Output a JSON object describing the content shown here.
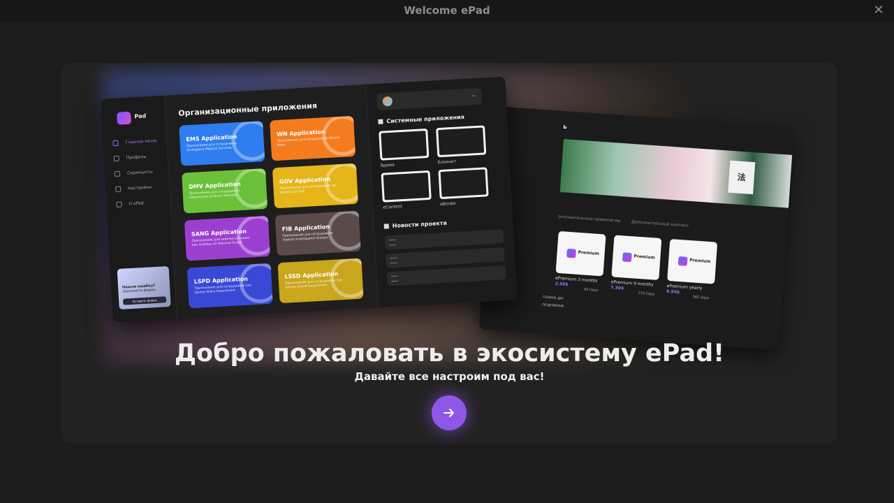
{
  "window": {
    "title": "Welcome ePad",
    "close_icon": "close-icon"
  },
  "preview": {
    "front": {
      "logo": "Pad",
      "nav": [
        "Главное меню",
        "Профиль",
        "Скриншоты",
        "Настройки",
        "O ePad"
      ],
      "promo": {
        "title": "Нашли ошибку?",
        "sub": "Заполните форму",
        "button": "Оставить форму"
      },
      "section_title": "Организационные приложения",
      "apps": [
        {
          "name": "EMS Application",
          "desc": "Приложение для сотрудников Emergency Medical Services",
          "color": "#2f7df0"
        },
        {
          "name": "WN Application",
          "desc": "Приложение для сотрудников Weazel News",
          "color": "#f47c1e"
        },
        {
          "name": "DMV Application",
          "desc": "Приложение для сотрудников Department of Motor Vehicles",
          "color": "#6cc13a"
        },
        {
          "name": "GOV Application",
          "desc": "Приложение для сотрудников Los Santos City Hall",
          "color": "#e5b51a"
        },
        {
          "name": "SANG Application",
          "desc": "Приложение для военнослужащих San Andreas Air National Guard",
          "color": "#9b3fd0"
        },
        {
          "name": "FIB Application",
          "desc": "Приложение для сотрудников Federal Investigation Bureau",
          "color": "#5a4a4a"
        },
        {
          "name": "LSPD Application",
          "desc": "Приложение для сотрудников Los-Santos Police Department",
          "color": "#3a48d6"
        },
        {
          "name": "LSSD Application",
          "desc": "Приложение для сотрудников Los-Santos Sheriff Department",
          "color": "#c9a61c"
        }
      ],
      "system_title": "Системные приложения",
      "system_apps": [
        "Время",
        "Блокнот",
        "eContent",
        "eBinder"
      ],
      "news_title": "Новости проекта"
    },
    "back": {
      "header": "ь",
      "tabs": [
        "ополнительные привилегии",
        "Дополнительный контент"
      ],
      "premium_label": "Premium",
      "plans": [
        {
          "name": "ePremium 3 months",
          "price": "2.50$",
          "days": "90 Days"
        },
        {
          "name": "ePremium 9 months",
          "price": "7.30$",
          "days": "270 Days"
        },
        {
          "name": "ePremium yearly",
          "price": "9.50$",
          "days": "365 Days"
        }
      ],
      "footer": [
        "плана до:",
        "подписки:"
      ]
    }
  },
  "headline": "Добро пожаловать в экосистему ePad!",
  "subline": "Давайте все настроим под вас!",
  "next_button": {
    "icon": "arrow-right-icon",
    "color": "#8e57e6"
  }
}
